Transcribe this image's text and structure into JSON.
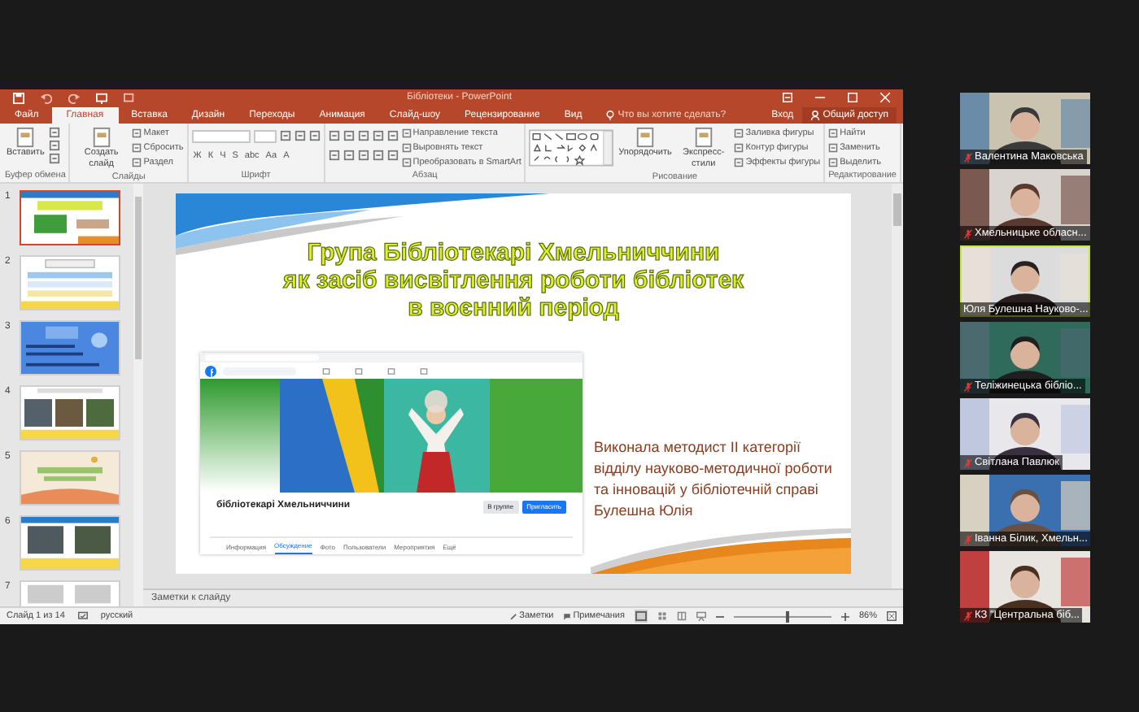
{
  "window": {
    "title": "Бібліотеки - PowerPoint"
  },
  "ribbon_tabs": [
    {
      "label": "Файл",
      "selected": false
    },
    {
      "label": "Главная",
      "selected": true
    },
    {
      "label": "Вставка",
      "selected": false
    },
    {
      "label": "Дизайн",
      "selected": false
    },
    {
      "label": "Переходы",
      "selected": false
    },
    {
      "label": "Анимация",
      "selected": false
    },
    {
      "label": "Слайд-шоу",
      "selected": false
    },
    {
      "label": "Рецензирование",
      "selected": false
    },
    {
      "label": "Вид",
      "selected": false
    }
  ],
  "tell_me": {
    "placeholder": "Что вы хотите сделать?"
  },
  "account": {
    "sign_in": "Вход",
    "share": "Общий доступ"
  },
  "ribbon_groups": [
    {
      "label": "Буфер обмена",
      "columns": [
        [
          {
            "kind": "large",
            "label": "Вставить"
          }
        ],
        [
          {
            "kind": "icon"
          },
          {
            "kind": "icon"
          },
          {
            "kind": "icon"
          }
        ]
      ]
    },
    {
      "label": "Слайды",
      "columns": [
        [
          {
            "kind": "large",
            "label": "Создать слайд"
          }
        ],
        [
          {
            "kind": "small",
            "label": "Макет"
          },
          {
            "kind": "small",
            "label": "Сбросить"
          },
          {
            "kind": "small",
            "label": "Раздел"
          }
        ]
      ]
    },
    {
      "label": "Шрифт",
      "columns": [
        [
          {
            "kind": "row",
            "items": [
              {
                "kind": "font_field"
              },
              {
                "kind": "size_field"
              },
              {
                "kind": "icon"
              },
              {
                "kind": "icon"
              },
              {
                "kind": "icon"
              }
            ]
          },
          {
            "kind": "row",
            "items": [
              {
                "kind": "glyph",
                "label": "Ж"
              },
              {
                "kind": "glyph",
                "label": "К"
              },
              {
                "kind": "glyph",
                "label": "Ч"
              },
              {
                "kind": "glyph",
                "label": "S"
              },
              {
                "kind": "glyph",
                "label": "abc"
              },
              {
                "kind": "glyph",
                "label": "Аа"
              },
              {
                "kind": "glyph",
                "label": "А"
              }
            ]
          }
        ]
      ]
    },
    {
      "label": "Абзац",
      "columns": [
        [
          {
            "kind": "row",
            "items": [
              {
                "kind": "icon"
              },
              {
                "kind": "icon"
              },
              {
                "kind": "icon"
              },
              {
                "kind": "icon"
              },
              {
                "kind": "icon"
              }
            ]
          },
          {
            "kind": "row",
            "items": [
              {
                "kind": "icon"
              },
              {
                "kind": "icon"
              },
              {
                "kind": "icon"
              },
              {
                "kind": "icon"
              },
              {
                "kind": "icon"
              }
            ]
          }
        ],
        [
          {
            "kind": "small",
            "label": "Направление текста"
          },
          {
            "kind": "small",
            "label": "Выровнять текст"
          },
          {
            "kind": "small",
            "label": "Преобразовать в SmartArt"
          }
        ]
      ]
    },
    {
      "label": "Рисование",
      "columns": [
        [
          {
            "kind": "gallery"
          }
        ],
        [
          {
            "kind": "large",
            "label": "Упорядочить"
          }
        ],
        [
          {
            "kind": "large",
            "label": "Экспресс-стили"
          }
        ],
        [
          {
            "kind": "small",
            "label": "Заливка фигуры"
          },
          {
            "kind": "small",
            "label": "Контур фигуры"
          },
          {
            "kind": "small",
            "label": "Эффекты фигуры"
          }
        ]
      ]
    },
    {
      "label": "Редактирование",
      "columns": [
        [
          {
            "kind": "small",
            "label": "Найти"
          },
          {
            "kind": "small",
            "label": "Заменить"
          },
          {
            "kind": "small",
            "label": "Выделить"
          }
        ]
      ]
    }
  ],
  "thumbnails": [
    {
      "number": "1",
      "selected": true
    },
    {
      "number": "2",
      "selected": false
    },
    {
      "number": "3",
      "selected": false
    },
    {
      "number": "4",
      "selected": false
    },
    {
      "number": "5",
      "selected": false
    },
    {
      "number": "6",
      "selected": false
    },
    {
      "number": "7",
      "selected": false
    }
  ],
  "slide": {
    "title_lines": [
      "Група Бібліотекарі Хмельниччини",
      "як засіб висвітлення роботи бібліотек",
      "в воєнний період"
    ],
    "author_lines": [
      "Виконала методист ІІ категорії",
      "відділу науково-методичної роботи",
      "та інновацій у бібліотечній справі",
      "Булешна Юлія"
    ],
    "facebook": {
      "group_name": "бібліотекарі Хмельниччини",
      "buttons": [
        "В группе",
        "Пригласить"
      ],
      "tabs": [
        {
          "label": "Информация",
          "selected": false
        },
        {
          "label": "Обсуждение",
          "selected": true
        },
        {
          "label": "Фото",
          "selected": false
        },
        {
          "label": "Пользователи",
          "selected": false
        },
        {
          "label": "Мероприятия",
          "selected": false
        },
        {
          "label": "Ещё",
          "selected": false
        }
      ]
    }
  },
  "notes": {
    "placeholder": "Заметки к слайду"
  },
  "status_bar": {
    "slide": "Слайд 1 из 14",
    "language": "русский",
    "notes": "Заметки",
    "comments": "Примечания",
    "zoom": "86%",
    "zoom_slider": {
      "level": 0.55
    }
  },
  "participants": [
    {
      "name": "Валентина Маковська",
      "muted": true,
      "active": false
    },
    {
      "name": "Хмельницьке обласн...",
      "muted": true,
      "active": false
    },
    {
      "name": "Юля Булешна Науково-...",
      "muted": false,
      "active": true
    },
    {
      "name": "Теліжинецька бібліо...",
      "muted": true,
      "active": false
    },
    {
      "name": "Світлана Павлюк",
      "muted": true,
      "active": false
    },
    {
      "name": "Іванна Білик, Хмельн...",
      "muted": true,
      "active": false
    },
    {
      "name": "КЗ \"Центральна біб...",
      "muted": true,
      "active": false
    }
  ]
}
